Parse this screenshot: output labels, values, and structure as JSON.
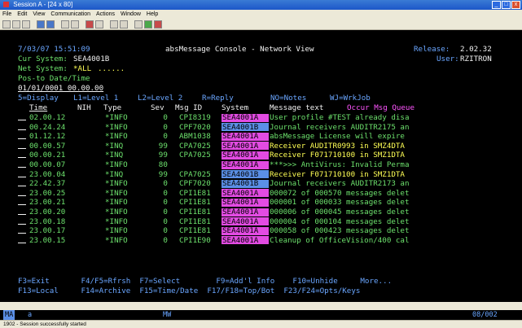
{
  "window": {
    "title": "Session A - [24 x 80]",
    "min": "_",
    "max": "□",
    "close": "x"
  },
  "menu": [
    "File",
    "Edit",
    "View",
    "Communication",
    "Actions",
    "Window",
    "Help"
  ],
  "header": {
    "datetime": "7/03/07 15:51:09",
    "app_title": "absMessage Console - Network View",
    "release_label": "Release:",
    "release_value": "2.02.32",
    "cur_system_label": "Cur System:",
    "cur_system_value": "SEA4001B",
    "user_label": "User:",
    "user_value": "RZITRON",
    "net_system_label": "Net System:",
    "net_system_value": "*ALL",
    "net_system_fill": "......",
    "pos_label": "Pos-to Date/Time",
    "pos_value": "01/01/0001 00.00.00"
  },
  "legend": [
    "5=Display",
    "L1=Level 1",
    "L2=Level 2",
    "R=Reply",
    "NO=Notes",
    "WJ=WrkJob"
  ],
  "columns": {
    "time": "Time",
    "nih": "NIH",
    "type": "Type",
    "sev": "Sev",
    "msgid": "Msg ID",
    "system": "System",
    "text": "Message text",
    "occur": "Occur Msg Queue"
  },
  "rows": [
    {
      "time": "02.00.12",
      "type": "*INFO",
      "sev": "0",
      "msgid": "CPI8319",
      "system": "SEA4001A",
      "text": "User profile #TEST already disa",
      "syscolor": "pink",
      "textcolor": "g"
    },
    {
      "time": "00.24.24",
      "type": "*INFO",
      "sev": "0",
      "msgid": "CPF7020",
      "system": "SEA4001B",
      "text": "Journal receivers AUDITR2175 an",
      "syscolor": "blue",
      "textcolor": "g"
    },
    {
      "time": "01.12.12",
      "type": "*INFO",
      "sev": "0",
      "msgid": "ABM1038",
      "system": "SEA4001A",
      "text": "absMessage License will expire",
      "syscolor": "pink",
      "textcolor": "g"
    },
    {
      "time": "00.00.57",
      "type": "*INQ",
      "sev": "99",
      "msgid": "CPA7025",
      "system": "SEA4001A",
      "text": "Receiver AUDITR0993 in SMZ4DTA",
      "syscolor": "pink",
      "textcolor": "y"
    },
    {
      "time": "00.00.21",
      "type": "*INQ",
      "sev": "99",
      "msgid": "CPA7025",
      "system": "SEA4001A",
      "text": "Receiver F071710100 in SMZ1DTA",
      "syscolor": "pink",
      "textcolor": "y"
    },
    {
      "time": "00.00.07",
      "type": "*INFO",
      "sev": "80",
      "msgid": "",
      "system": "SEA4001A",
      "text": "***>>> AntiVirus: Invalid Perma",
      "syscolor": "pink",
      "textcolor": "g"
    },
    {
      "time": "23.00.04",
      "type": "*INQ",
      "sev": "99",
      "msgid": "CPA7025",
      "system": "SEA4001B",
      "text": "Receiver F071710100 in SMZ1DTA",
      "syscolor": "blue",
      "textcolor": "y"
    },
    {
      "time": "22.42.37",
      "type": "*INFO",
      "sev": "0",
      "msgid": "CPF7020",
      "system": "SEA4001B",
      "text": "Journal receivers AUDITR2173 an",
      "syscolor": "blue",
      "textcolor": "g"
    },
    {
      "time": "23.00.25",
      "type": "*INFO",
      "sev": "0",
      "msgid": "CPI1E81",
      "system": "SEA4001A",
      "text": "000072 of 000570 messages delet",
      "syscolor": "pink",
      "textcolor": "g"
    },
    {
      "time": "23.00.21",
      "type": "*INFO",
      "sev": "0",
      "msgid": "CPI1E81",
      "system": "SEA4001A",
      "text": "000001 of 000033 messages delet",
      "syscolor": "pink",
      "textcolor": "g"
    },
    {
      "time": "23.00.20",
      "type": "*INFO",
      "sev": "0",
      "msgid": "CPI1E81",
      "system": "SEA4001A",
      "text": "000006 of 000045 messages delet",
      "syscolor": "pink",
      "textcolor": "g"
    },
    {
      "time": "23.00.18",
      "type": "*INFO",
      "sev": "0",
      "msgid": "CPI1E81",
      "system": "SEA4001A",
      "text": "000004 of 000104 messages delet",
      "syscolor": "pink",
      "textcolor": "g"
    },
    {
      "time": "23.00.17",
      "type": "*INFO",
      "sev": "0",
      "msgid": "CPI1E81",
      "system": "SEA4001A",
      "text": "000058 of 000423 messages delet",
      "syscolor": "pink",
      "textcolor": "g"
    },
    {
      "time": "23.00.15",
      "type": "*INFO",
      "sev": "0",
      "msgid": "CPI1E90",
      "system": "SEA4001A",
      "text": "Cleanup of OfficeVision/400 cal",
      "syscolor": "pink",
      "textcolor": "g"
    }
  ],
  "fkeys_row1": "F3=Exit       F4/F5=Rfrsh  F7=Select        F9=Add'l Info    F10=Unhide     More...",
  "fkeys_row2": "F13=Local     F14=Archive  F15=Time/Date  F17/F18=Top/Bot  F23/F24=Opts/Keys",
  "status": {
    "ma": "MA",
    "a": "a",
    "mw": "MW",
    "pos": "08/002"
  },
  "bottom": "1902 - Session successfully started"
}
